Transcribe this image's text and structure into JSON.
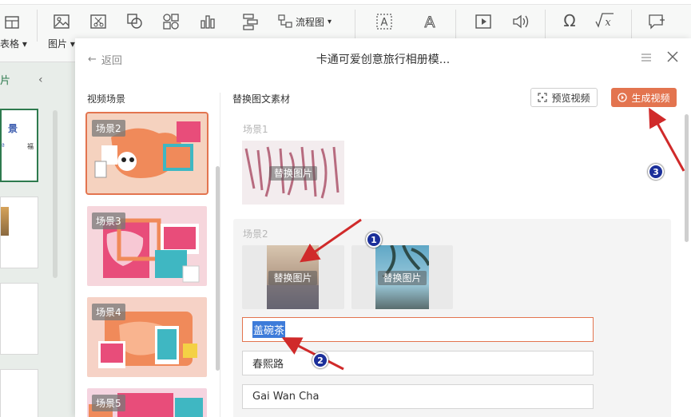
{
  "ribbon": {
    "table_label": "表格",
    "picture_label": "图片",
    "flowchart_label": "流程图"
  },
  "left_panel": {
    "header": "片",
    "thumb1_text": "景",
    "thumb1_small_left": "ª",
    "thumb1_small_right": "福"
  },
  "dialog": {
    "back_label": "返回",
    "title": "卡通可爱创意旅行相册模...",
    "scenes_title": "视频场景",
    "replace_title": "替换图文素材",
    "preview_button": "预览视频",
    "generate_button": "生成视频",
    "scenes": [
      {
        "label": "场景2"
      },
      {
        "label": "场景3"
      },
      {
        "label": "场景4"
      },
      {
        "label": "场景5"
      }
    ],
    "section1_label": "场景1",
    "section2_label": "场景2",
    "replace_image_label": "替换图片",
    "inputs": [
      {
        "value": "盖碗茶"
      },
      {
        "value": "春熙路"
      },
      {
        "value": "Gai Wan Cha"
      }
    ]
  },
  "badges": [
    "1",
    "2",
    "3"
  ],
  "colors": {
    "accent": "#e3744f",
    "selection": "#3d7bd9",
    "badge": "#1b2f9a",
    "arrow": "#d02a2a"
  }
}
